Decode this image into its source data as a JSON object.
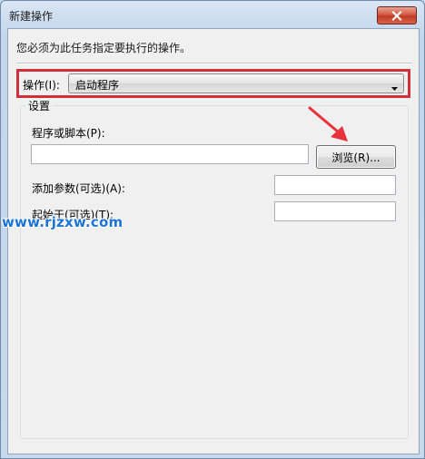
{
  "window": {
    "title": "新建操作"
  },
  "instruction": "您必须为此任务指定要执行的操作。",
  "action": {
    "label": "操作(I):",
    "selected": "启动程序"
  },
  "settings": {
    "group_label": "设置",
    "program_label": "程序或脚本(P):",
    "program_value": "",
    "browse_label": "浏览(R)...",
    "arguments_label": "添加参数(可选)(A):",
    "arguments_value": "",
    "start_in_label": "起始于(可选)(T):",
    "start_in_value": ""
  },
  "watermark": "www.rjzxw.com",
  "colors": {
    "highlight_border": "#d22f3e",
    "annotation_arrow": "#e8323c",
    "watermark": "#1b74d6",
    "close_button": "#c8432c"
  },
  "icons": {
    "close": "close-icon",
    "dropdown": "chevron-down-icon",
    "annotation": "red-arrow-annotation"
  }
}
